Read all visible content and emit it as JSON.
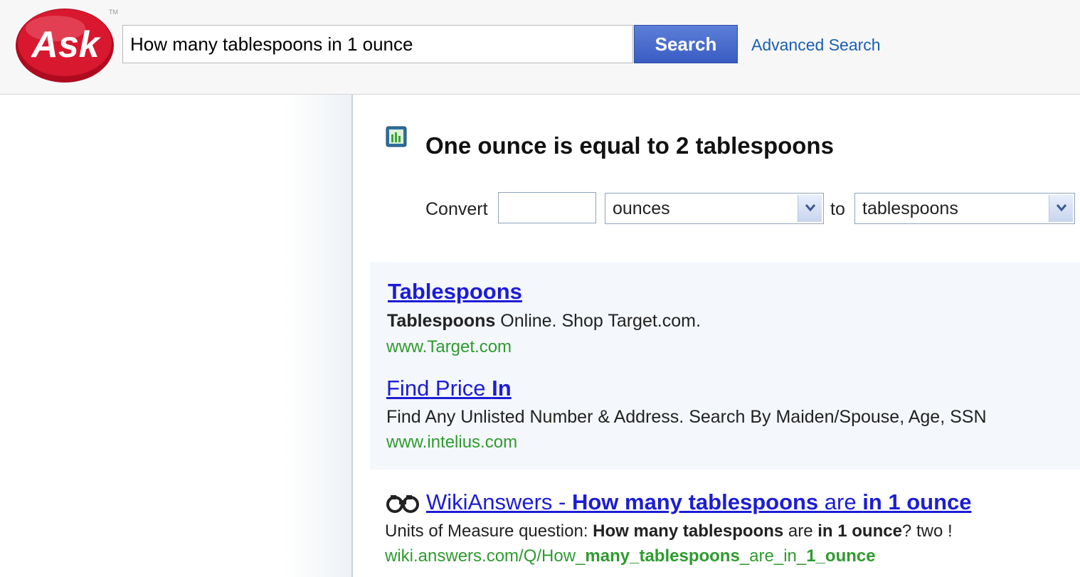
{
  "header": {
    "logo_text": "Ask",
    "trademark": "TM",
    "search_value": "How many tablespoons in 1 ounce",
    "search_button": "Search",
    "advanced_link": "Advanced Search"
  },
  "answer": {
    "headline": "One ounce is equal to 2 tablespoons",
    "convert_label": "Convert",
    "convert_value": "",
    "from_unit": "ounces",
    "to_label": "to",
    "to_unit": "tablespoons"
  },
  "ads": [
    {
      "title": "Tablespoons",
      "desc_bold": "Tablespoons",
      "desc_rest": " Online. Shop Target.com.",
      "url": "www.Target.com"
    },
    {
      "title_plain": "Find Price ",
      "title_bold": "In",
      "desc": "Find Any Unlisted Number & Address. Search By Maiden/Spouse, Age, SSN",
      "url": "www.intelius.com"
    }
  ],
  "result": {
    "title_parts": [
      "WikiAnswers - ",
      "How many tablespoons",
      " are ",
      "in 1 ounce"
    ],
    "desc_parts": [
      "Units of Measure question: ",
      "How many tablespoons",
      " are ",
      "in 1 ounce",
      "? two !"
    ],
    "url_parts": [
      "wiki.answers.com/Q/How_",
      "many_tablespoons",
      "_are_in_",
      "1_ounce"
    ]
  },
  "colors": {
    "link": "#1c1cd6",
    "url_green": "#2e9b2e",
    "search_button": "#3a5cc2",
    "logo_red": "#c8102e"
  }
}
